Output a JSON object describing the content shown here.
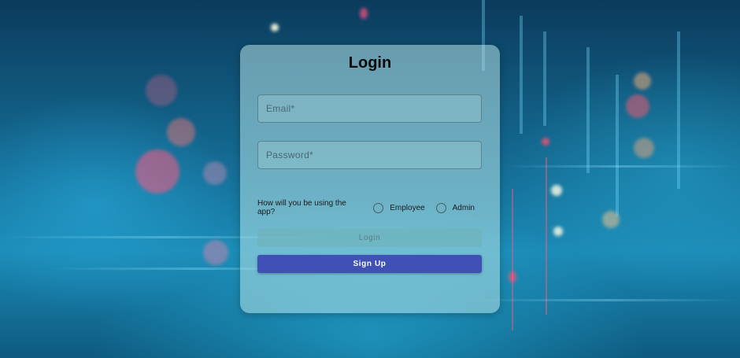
{
  "login_card": {
    "title": "Login",
    "email_placeholder": "Email*",
    "password_placeholder": "Password*",
    "role_question": "How will you be using the app?",
    "role_options": [
      "Employee",
      "Admin"
    ],
    "login_label": "Login",
    "signup_label": "Sign Up"
  },
  "colors": {
    "signup_button": "#3f51b5",
    "card_background": "rgba(180,225,230,0.55)"
  }
}
